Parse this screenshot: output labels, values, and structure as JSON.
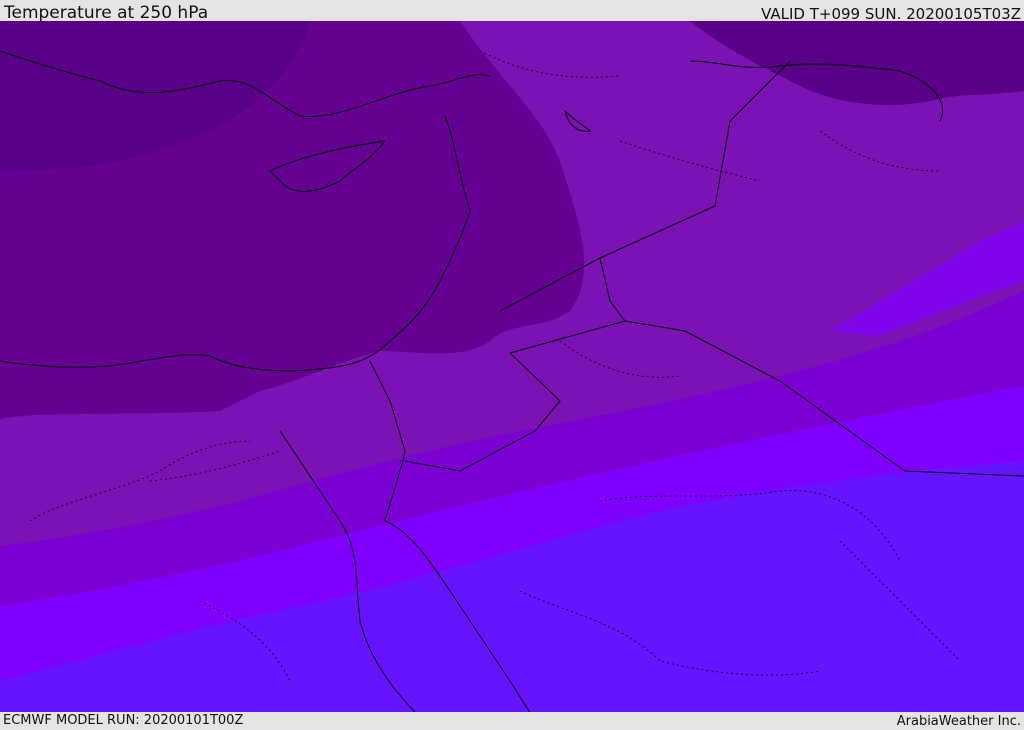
{
  "header": {
    "title": "Temperature at 250 hPa",
    "valid": "VALID T+099 SUN. 20200105T03Z"
  },
  "footer": {
    "model_run": "ECMWF MODEL RUN: 20200101T00Z",
    "credit": "ArabiaWeather Inc."
  },
  "map": {
    "colors": {
      "band_coldest": "#5a0088",
      "band_cold": "#640092",
      "band_mid": "#7a12b4",
      "band_warm": "#7b00d2",
      "band_warmer": "#8000ff",
      "band_warmest": "#6614ff",
      "land_outline": "#000000"
    }
  }
}
